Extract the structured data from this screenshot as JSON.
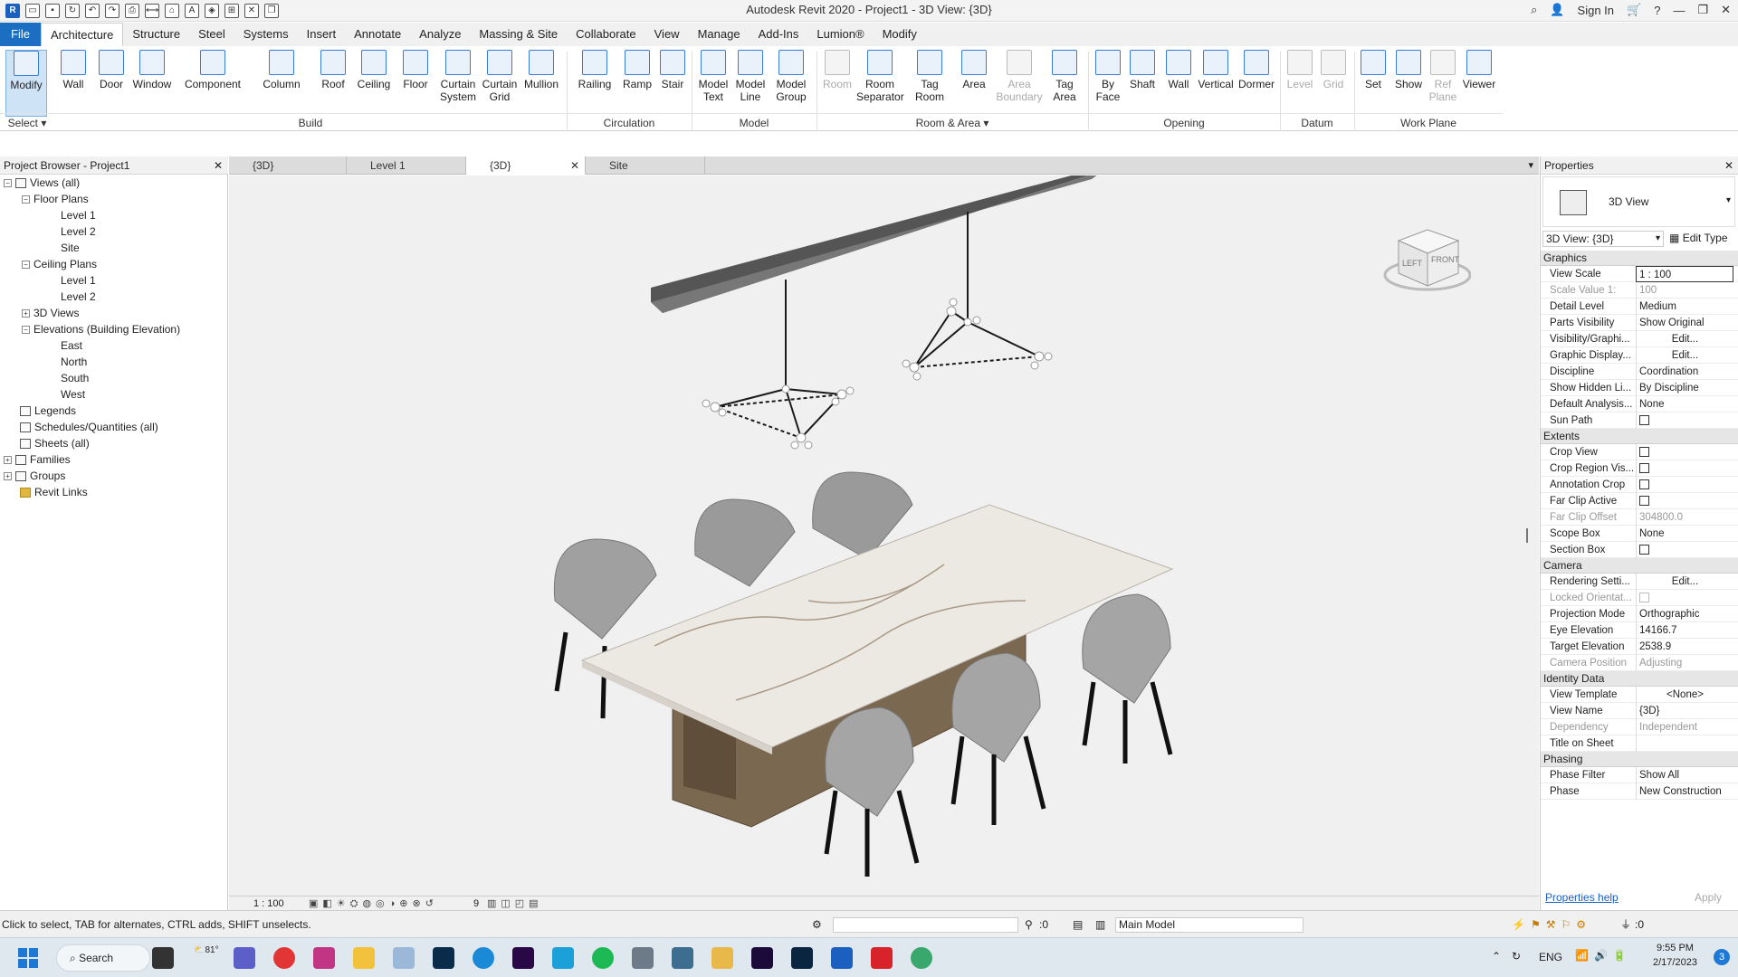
{
  "window": {
    "title": "Autodesk Revit 2020 - Project1 - 3D View: {3D}",
    "sign_in": "Sign In"
  },
  "tabs": [
    "File",
    "Architecture",
    "Structure",
    "Steel",
    "Systems",
    "Insert",
    "Annotate",
    "Analyze",
    "Massing & Site",
    "Collaborate",
    "View",
    "Manage",
    "Add-Ins",
    "Lumion®",
    "Modify"
  ],
  "ribbon": {
    "tools": [
      "Modify",
      "Wall",
      "Door",
      "Window",
      "Component",
      "Column",
      "Roof",
      "Ceiling",
      "Floor",
      "Curtain System",
      "Curtain Grid",
      "Mullion",
      "Railing",
      "Ramp",
      "Stair",
      "Model Text",
      "Model Line",
      "Model Group",
      "Room",
      "Room Separator",
      "Tag Room",
      "Area",
      "Area Boundary",
      "Tag Area",
      "By Face",
      "Shaft",
      "Wall",
      "Vertical",
      "Dormer",
      "Level",
      "Grid",
      "Set",
      "Show",
      "Ref Plane",
      "Viewer"
    ],
    "panels": [
      "Select",
      "Build",
      "Circulation",
      "Model",
      "Room & Area",
      "Opening",
      "Datum",
      "Work Plane"
    ]
  },
  "browser": {
    "title": "Project Browser - Project1",
    "items": [
      "Views (all)",
      "Floor Plans",
      "Level 1",
      "Level 2",
      "Site",
      "Ceiling Plans",
      "Level 1",
      "Level 2",
      "3D Views",
      "Elevations (Building Elevation)",
      "East",
      "North",
      "South",
      "West",
      "Legends",
      "Schedules/Quantities (all)",
      "Sheets (all)",
      "Families",
      "Groups",
      "Revit Links"
    ]
  },
  "view_tabs": [
    "{3D}",
    "Level 1",
    "{3D}",
    "Site"
  ],
  "viewcube": {
    "left": "LEFT",
    "front": "FRONT"
  },
  "viewbar": {
    "scale": "1 : 100",
    "count": "9"
  },
  "properties": {
    "title": "Properties",
    "type_name": "3D View",
    "selector": "3D View: {3D}",
    "edit_type": "Edit Type",
    "groups": {
      "graphics": "Graphics",
      "extents": "Extents",
      "camera": "Camera",
      "identity": "Identity Data",
      "phasing": "Phasing"
    },
    "rows": {
      "view_scale": [
        "View Scale",
        "1 : 100"
      ],
      "scale_value": [
        "Scale Value 1:",
        "100"
      ],
      "detail_level": [
        "Detail Level",
        "Medium"
      ],
      "parts_visibility": [
        "Parts Visibility",
        "Show Original"
      ],
      "vis_graphics": [
        "Visibility/Graphi...",
        "Edit..."
      ],
      "graphic_display": [
        "Graphic Display...",
        "Edit..."
      ],
      "discipline": [
        "Discipline",
        "Coordination"
      ],
      "show_hidden": [
        "Show Hidden Li...",
        "By Discipline"
      ],
      "default_analysis": [
        "Default Analysis...",
        "None"
      ],
      "sun_path": [
        "Sun Path",
        ""
      ],
      "crop_view": [
        "Crop View",
        ""
      ],
      "crop_region": [
        "Crop Region Vis...",
        ""
      ],
      "annotation_crop": [
        "Annotation Crop",
        ""
      ],
      "far_clip_active": [
        "Far Clip Active",
        ""
      ],
      "far_clip_offset": [
        "Far Clip Offset",
        "304800.0"
      ],
      "scope_box": [
        "Scope Box",
        "None"
      ],
      "section_box": [
        "Section Box",
        ""
      ],
      "rendering": [
        "Rendering Setti...",
        "Edit..."
      ],
      "locked_orient": [
        "Locked Orientat...",
        ""
      ],
      "projection": [
        "Projection Mode",
        "Orthographic"
      ],
      "eye_elev": [
        "Eye Elevation",
        "14166.7"
      ],
      "target_elev": [
        "Target Elevation",
        "2538.9"
      ],
      "camera_pos": [
        "Camera Position",
        "Adjusting"
      ],
      "view_template": [
        "View Template",
        "<None>"
      ],
      "view_name": [
        "View Name",
        "{3D}"
      ],
      "dependency": [
        "Dependency",
        "Independent"
      ],
      "title_sheet": [
        "Title on Sheet",
        ""
      ],
      "phase_filter": [
        "Phase Filter",
        "Show All"
      ],
      "phase": [
        "Phase",
        "New Construction"
      ]
    },
    "help": "Properties help",
    "apply": "Apply"
  },
  "status": {
    "hint": "Click to select, TAB for alternates, CTRL adds, SHIFT unselects.",
    "zero": ":0",
    "model": "Main Model",
    "filter": ":0"
  },
  "taskbar": {
    "search": "Search",
    "temp": "81°",
    "lang": "ENG",
    "time": "9:55 PM",
    "date": "2/17/2023",
    "badge": "3"
  }
}
